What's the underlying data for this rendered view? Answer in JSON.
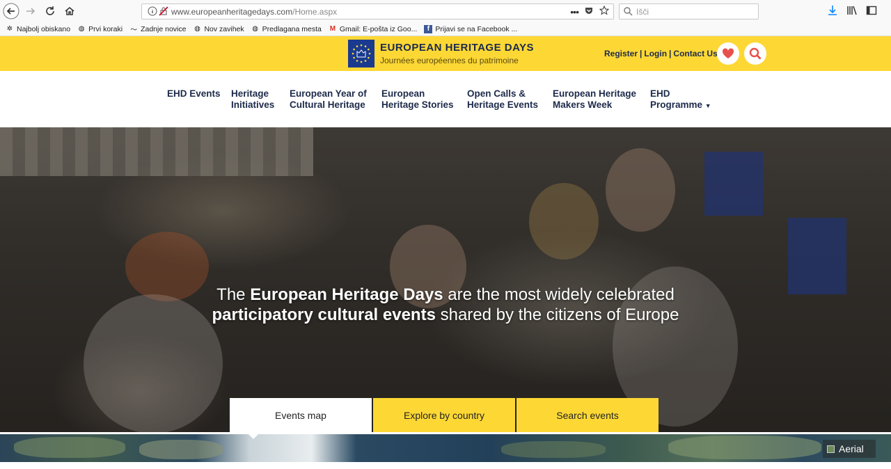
{
  "browser": {
    "url_main": "www.europeanheritagedays.com",
    "url_path": "/Home.aspx",
    "search_placeholder": "Išči",
    "bookmarks": [
      {
        "label": "Najbolj obiskano",
        "icon": "gear-icon"
      },
      {
        "label": "Prvi koraki",
        "icon": "globe-icon"
      },
      {
        "label": "Zadnje novice",
        "icon": "rss-icon"
      },
      {
        "label": "Nov zavihek",
        "icon": "globe-icon"
      },
      {
        "label": "Predlagana mesta",
        "icon": "globe-icon"
      },
      {
        "label": "Gmail: E-pošta iz Goo...",
        "icon": "gmail-icon"
      },
      {
        "label": "Prijavi se na Facebook ...",
        "icon": "facebook-icon"
      }
    ]
  },
  "header": {
    "title": "EUROPEAN HERITAGE DAYS",
    "subtitle": "Journées européennes du patrimoine",
    "links": [
      "Register",
      "Login",
      "Contact Us"
    ],
    "colors": {
      "brand_yellow": "#fdd835",
      "navy": "#1c2a4a",
      "logo_blue": "#1a3a8f"
    }
  },
  "nav": {
    "items": [
      {
        "line1": "EHD Events",
        "line2": ""
      },
      {
        "line1": "Heritage",
        "line2": "Initiatives"
      },
      {
        "line1": "European Year of",
        "line2": "Cultural Heritage"
      },
      {
        "line1": "European",
        "line2": "Heritage Stories"
      },
      {
        "line1": "Open Calls &",
        "line2": "Heritage Events"
      },
      {
        "line1": "European Heritage",
        "line2": "Makers Week"
      },
      {
        "line1": "EHD",
        "line2": "Programme"
      }
    ]
  },
  "hero": {
    "line1_pre": "The ",
    "line1_bold": "European Heritage Days",
    "line1_post": " are the most widely celebrated",
    "line2_bold": "participatory cultural events",
    "line2_post": " shared by the citizens of Europe"
  },
  "tabs": [
    "Events map",
    "Explore by country",
    "Search events"
  ],
  "map": {
    "layer_label": "Aerial"
  }
}
